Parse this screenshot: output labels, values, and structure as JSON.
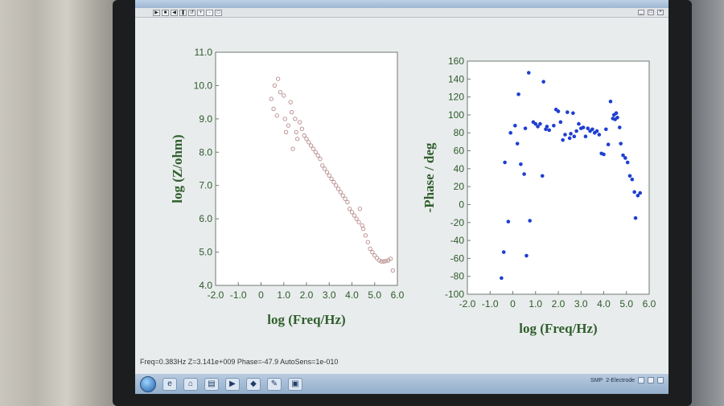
{
  "status_line": "Freq=0.383Hz  Z=3.141e+009  Phase=-47.9  AutoSens=1e-010",
  "toolbar": {
    "buttons": [
      "▶",
      "■",
      "◀",
      "❚",
      "↺",
      "+",
      "-",
      "□"
    ]
  },
  "taskbar": {
    "icons": [
      "e",
      "⌂",
      "▤",
      "▶",
      "◆",
      "✎",
      "▣"
    ],
    "tray_labels": [
      "SMP",
      "2-Electrode"
    ]
  },
  "chart_data": [
    {
      "type": "scatter",
      "title": "",
      "xlabel": "log (Freq/Hz)",
      "ylabel": "log (Z/ohm)",
      "xlim": [
        -2.0,
        6.0
      ],
      "ylim": [
        4.0,
        11.0
      ],
      "xticks": [
        "-2.0",
        "-1.0",
        "0",
        "1.0",
        "2.0",
        "3.0",
        "4.0",
        "5.0",
        "6.0"
      ],
      "yticks": [
        "4.0",
        "5.0",
        "6.0",
        "7.0",
        "8.0",
        "9.0",
        "10.0",
        "11.0"
      ],
      "grid": false,
      "marker": "open-circle",
      "color": "#b88a8a",
      "points": [
        [
          0.45,
          9.6
        ],
        [
          0.55,
          9.3
        ],
        [
          0.6,
          10.0
        ],
        [
          0.75,
          10.2
        ],
        [
          0.85,
          9.8
        ],
        [
          0.7,
          9.1
        ],
        [
          1.05,
          9.0
        ],
        [
          1.0,
          9.7
        ],
        [
          1.1,
          8.6
        ],
        [
          1.2,
          8.8
        ],
        [
          1.3,
          9.5
        ],
        [
          1.35,
          9.2
        ],
        [
          1.4,
          8.1
        ],
        [
          1.5,
          9.0
        ],
        [
          1.55,
          8.6
        ],
        [
          1.6,
          8.4
        ],
        [
          1.7,
          8.9
        ],
        [
          1.8,
          8.7
        ],
        [
          1.9,
          8.5
        ],
        [
          2.0,
          8.4
        ],
        [
          2.1,
          8.3
        ],
        [
          2.2,
          8.2
        ],
        [
          2.3,
          8.1
        ],
        [
          2.4,
          8.0
        ],
        [
          2.5,
          7.9
        ],
        [
          2.6,
          7.8
        ],
        [
          2.7,
          7.6
        ],
        [
          2.8,
          7.5
        ],
        [
          2.9,
          7.4
        ],
        [
          3.0,
          7.3
        ],
        [
          3.1,
          7.2
        ],
        [
          3.2,
          7.1
        ],
        [
          3.3,
          7.0
        ],
        [
          3.4,
          6.9
        ],
        [
          3.5,
          6.8
        ],
        [
          3.6,
          6.7
        ],
        [
          3.7,
          6.6
        ],
        [
          3.8,
          6.5
        ],
        [
          3.9,
          6.3
        ],
        [
          4.0,
          6.2
        ],
        [
          4.1,
          6.1
        ],
        [
          4.2,
          6.0
        ],
        [
          4.3,
          5.9
        ],
        [
          4.35,
          6.3
        ],
        [
          4.45,
          5.8
        ],
        [
          4.5,
          5.7
        ],
        [
          4.6,
          5.5
        ],
        [
          4.7,
          5.3
        ],
        [
          4.8,
          5.1
        ],
        [
          4.9,
          5.0
        ],
        [
          5.0,
          4.9
        ],
        [
          5.1,
          4.82
        ],
        [
          5.2,
          4.75
        ],
        [
          5.3,
          4.72
        ],
        [
          5.4,
          4.72
        ],
        [
          5.5,
          4.73
        ],
        [
          5.6,
          4.75
        ],
        [
          5.7,
          4.8
        ],
        [
          5.8,
          4.45
        ]
      ]
    },
    {
      "type": "scatter",
      "title": "",
      "xlabel": "log (Freq/Hz)",
      "ylabel": "-Phase / deg",
      "xlim": [
        -2.0,
        6.0
      ],
      "ylim": [
        -100,
        160
      ],
      "xticks": [
        "-2.0",
        "-1.0",
        "0",
        "1.0",
        "2.0",
        "3.0",
        "4.0",
        "5.0",
        "6.0"
      ],
      "yticks": [
        "-100",
        "-80",
        "-60",
        "-40",
        "-20",
        "0",
        "20",
        "40",
        "60",
        "80",
        "100",
        "120",
        "140",
        "160"
      ],
      "grid": false,
      "marker": "filled-circle",
      "color": "#1f3fd0",
      "points": [
        [
          -0.5,
          -82
        ],
        [
          -0.4,
          -53
        ],
        [
          -0.35,
          47
        ],
        [
          -0.2,
          -19
        ],
        [
          -0.1,
          80
        ],
        [
          0.1,
          88
        ],
        [
          0.2,
          68
        ],
        [
          0.25,
          123
        ],
        [
          0.35,
          45
        ],
        [
          0.5,
          34
        ],
        [
          0.55,
          85
        ],
        [
          0.6,
          -57
        ],
        [
          0.7,
          147
        ],
        [
          0.75,
          -18
        ],
        [
          0.9,
          92
        ],
        [
          1.0,
          90
        ],
        [
          1.1,
          87
        ],
        [
          1.2,
          90
        ],
        [
          1.35,
          137
        ],
        [
          1.3,
          32
        ],
        [
          1.45,
          84
        ],
        [
          1.5,
          87
        ],
        [
          1.6,
          83
        ],
        [
          1.8,
          88
        ],
        [
          1.9,
          106
        ],
        [
          2.0,
          104
        ],
        [
          2.1,
          92
        ],
        [
          2.2,
          72
        ],
        [
          2.3,
          78
        ],
        [
          2.4,
          103
        ],
        [
          2.5,
          74
        ],
        [
          2.55,
          79
        ],
        [
          2.65,
          102
        ],
        [
          2.7,
          76
        ],
        [
          2.8,
          82
        ],
        [
          2.9,
          90
        ],
        [
          3.0,
          85
        ],
        [
          3.1,
          86
        ],
        [
          3.2,
          76
        ],
        [
          3.3,
          85
        ],
        [
          3.4,
          82
        ],
        [
          3.5,
          84
        ],
        [
          3.6,
          80
        ],
        [
          3.7,
          82
        ],
        [
          3.8,
          78
        ],
        [
          3.9,
          57
        ],
        [
          4.0,
          56
        ],
        [
          4.1,
          84
        ],
        [
          4.2,
          67
        ],
        [
          4.3,
          115
        ],
        [
          4.4,
          96
        ],
        [
          4.45,
          100
        ],
        [
          4.5,
          95
        ],
        [
          4.55,
          102
        ],
        [
          4.6,
          97
        ],
        [
          4.7,
          86
        ],
        [
          4.75,
          68
        ],
        [
          4.85,
          55
        ],
        [
          4.95,
          52
        ],
        [
          5.05,
          47
        ],
        [
          5.15,
          32
        ],
        [
          5.25,
          28
        ],
        [
          5.35,
          14
        ],
        [
          5.4,
          -15
        ],
        [
          5.5,
          10
        ],
        [
          5.6,
          13
        ]
      ]
    }
  ]
}
